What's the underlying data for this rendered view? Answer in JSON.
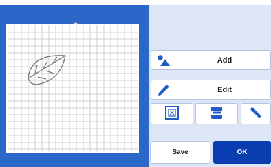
{
  "screen": {
    "name": "mat-preview-editor"
  },
  "canvas": {
    "grid": "mat-grid",
    "shape": "leaf-outline"
  },
  "actions": {
    "add_label": "Add",
    "add_icon": "shapes-icon",
    "edit_label": "Edit",
    "edit_icon": "pencil-icon"
  },
  "tools": [
    {
      "name": "fit-to-mat-button",
      "icon": "frame-icon"
    },
    {
      "name": "layout-button",
      "icon": "layers-icon"
    },
    {
      "name": "settings-button",
      "icon": "wrench-icon"
    }
  ],
  "footer": {
    "save_label": "Save",
    "ok_label": "OK"
  },
  "colors": {
    "panel_blue": "#2a67c9",
    "ok_blue": "#0a3db0",
    "control_bg": "#dde6f7",
    "icon_blue": "#1f5cc4"
  }
}
